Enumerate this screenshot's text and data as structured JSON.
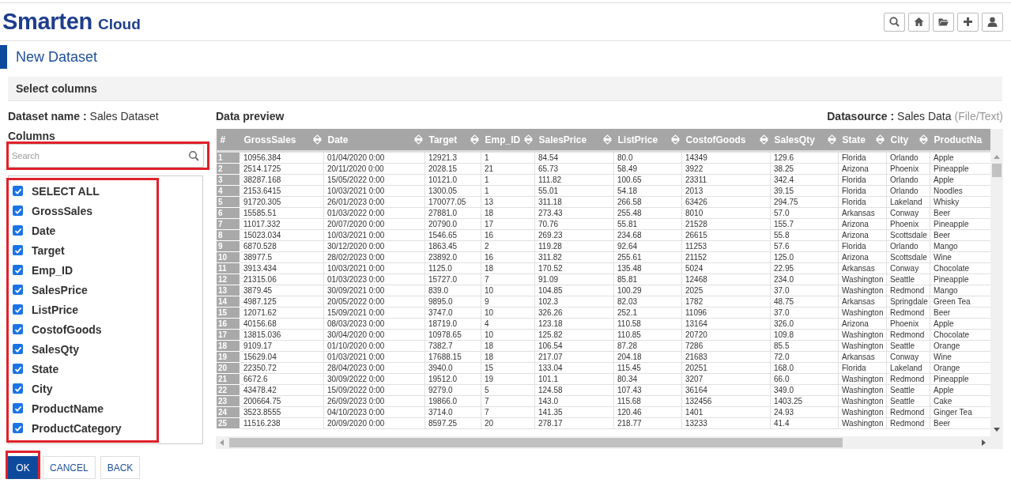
{
  "header": {
    "logo": {
      "brand": "Smarten",
      "product": "Cloud"
    },
    "toolbar": [
      {
        "kind": "search"
      },
      {
        "kind": "home"
      },
      {
        "kind": "folder"
      },
      {
        "kind": "plus"
      },
      {
        "kind": "user"
      }
    ]
  },
  "page_title": "New Dataset",
  "section_title": "Select columns",
  "dataset_name": {
    "label": "Dataset name :",
    "value": "Sales Dataset"
  },
  "columns": {
    "label": "Columns",
    "search": {
      "placeholder": "Search"
    },
    "items": [
      {
        "label": "SELECT ALL",
        "checked": true
      },
      {
        "label": "GrossSales",
        "checked": true
      },
      {
        "label": "Date",
        "checked": true
      },
      {
        "label": "Target",
        "checked": true
      },
      {
        "label": "Emp_ID",
        "checked": true
      },
      {
        "label": "SalesPrice",
        "checked": true
      },
      {
        "label": "ListPrice",
        "checked": true
      },
      {
        "label": "CostofGoods",
        "checked": true
      },
      {
        "label": "SalesQty",
        "checked": true
      },
      {
        "label": "State",
        "checked": true
      },
      {
        "label": "City",
        "checked": true
      },
      {
        "label": "ProductName",
        "checked": true
      },
      {
        "label": "ProductCategory",
        "checked": true
      }
    ]
  },
  "preview": {
    "title": "Data preview",
    "datasource": {
      "label": "Datasource :",
      "value": "Sales Data",
      "type": "(File/Text)"
    },
    "table": {
      "columns": [
        "#",
        "GrossSales",
        "Date",
        "Target",
        "Emp_ID",
        "SalesPrice",
        "ListPrice",
        "CostofGoods",
        "SalesQty",
        "State",
        "City",
        "ProductNa"
      ],
      "rows": [
        [
          "1",
          "10956.384",
          "01/04/2020 0:00",
          "12921.3",
          "1",
          "84.54",
          "80.0",
          "14349",
          "129.6",
          "Florida",
          "Orlando",
          "Apple"
        ],
        [
          "2",
          "2514.1725",
          "20/11/2020 0:00",
          "2028.15",
          "21",
          "65.73",
          "58.49",
          "3922",
          "38.25",
          "Arizona",
          "Phoenix",
          "Pineapple"
        ],
        [
          "3",
          "38287.168",
          "15/05/2022 0:00",
          "10121.0",
          "1",
          "111.82",
          "100.65",
          "23311",
          "342.4",
          "Florida",
          "Orlando",
          "Apple"
        ],
        [
          "4",
          "2153.6415",
          "10/03/2021 0:00",
          "1300.05",
          "1",
          "55.01",
          "54.18",
          "2013",
          "39.15",
          "Florida",
          "Orlando",
          "Noodles"
        ],
        [
          "5",
          "91720.305",
          "26/01/2023 0:00",
          "170077.05",
          "13",
          "311.18",
          "266.58",
          "63426",
          "294.75",
          "Florida",
          "Lakeland",
          "Whisky"
        ],
        [
          "6",
          "15585.51",
          "01/03/2022 0:00",
          "27881.0",
          "18",
          "273.43",
          "255.48",
          "8010",
          "57.0",
          "Arkansas",
          "Conway",
          "Beer"
        ],
        [
          "7",
          "11017.332",
          "20/07/2020 0:00",
          "20790.0",
          "17",
          "70.76",
          "55.81",
          "21528",
          "155.7",
          "Arizona",
          "Phoenix",
          "Pineapple"
        ],
        [
          "8",
          "15023.034",
          "10/03/2021 0:00",
          "1546.65",
          "16",
          "269.23",
          "234.68",
          "26615",
          "55.8",
          "Arizona",
          "Scottsdale",
          "Beer"
        ],
        [
          "9",
          "6870.528",
          "30/12/2020 0:00",
          "1863.45",
          "2",
          "119.28",
          "92.64",
          "11253",
          "57.6",
          "Florida",
          "Orlando",
          "Mango"
        ],
        [
          "10",
          "38977.5",
          "28/02/2023 0:00",
          "23892.0",
          "16",
          "311.82",
          "255.61",
          "21152",
          "125.0",
          "Arizona",
          "Scottsdale",
          "Wine"
        ],
        [
          "11",
          "3913.434",
          "10/03/2021 0:00",
          "1125.0",
          "18",
          "170.52",
          "135.48",
          "5024",
          "22.95",
          "Arkansas",
          "Conway",
          "Chocolate"
        ],
        [
          "12",
          "21315.06",
          "01/03/2023 0:00",
          "15727.0",
          "7",
          "91.09",
          "85.81",
          "12468",
          "234.0",
          "Washington",
          "Seattle",
          "Pineapple"
        ],
        [
          "13",
          "3879.45",
          "30/09/2021 0:00",
          "839.0",
          "10",
          "104.85",
          "100.29",
          "2025",
          "37.0",
          "Washington",
          "Redmond",
          "Mango"
        ],
        [
          "14",
          "4987.125",
          "20/05/2022 0:00",
          "9895.0",
          "9",
          "102.3",
          "82.03",
          "1782",
          "48.75",
          "Arkansas",
          "Springdale",
          "Green Tea"
        ],
        [
          "15",
          "12071.62",
          "15/09/2021 0:00",
          "3747.0",
          "10",
          "326.26",
          "252.1",
          "11096",
          "37.0",
          "Washington",
          "Redmond",
          "Beer"
        ],
        [
          "16",
          "40156.68",
          "08/03/2023 0:00",
          "18719.0",
          "4",
          "123.18",
          "110.58",
          "13164",
          "326.0",
          "Arizona",
          "Phoenix",
          "Apple"
        ],
        [
          "17",
          "13815.036",
          "30/04/2020 0:00",
          "10978.65",
          "10",
          "125.82",
          "110.85",
          "20720",
          "109.8",
          "Washington",
          "Redmond",
          "Chocolate"
        ],
        [
          "18",
          "9109.17",
          "01/10/2020 0:00",
          "7382.7",
          "18",
          "106.54",
          "87.28",
          "7286",
          "85.5",
          "Washington",
          "Seattle",
          "Orange"
        ],
        [
          "19",
          "15629.04",
          "01/03/2021 0:00",
          "17688.15",
          "18",
          "217.07",
          "204.18",
          "21683",
          "72.0",
          "Arkansas",
          "Conway",
          "Wine"
        ],
        [
          "20",
          "22350.72",
          "28/04/2023 0:00",
          "3940.0",
          "15",
          "133.04",
          "115.45",
          "20251",
          "168.0",
          "Florida",
          "Lakeland",
          "Orange"
        ],
        [
          "21",
          "6672.6",
          "30/09/2022 0:00",
          "19512.0",
          "19",
          "101.1",
          "80.34",
          "3207",
          "66.0",
          "Washington",
          "Redmond",
          "Pineapple"
        ],
        [
          "22",
          "43478.42",
          "15/09/2022 0:00",
          "9279.0",
          "5",
          "124.58",
          "107.43",
          "36164",
          "349.0",
          "Washington",
          "Seattle",
          "Apple"
        ],
        [
          "23",
          "200664.75",
          "26/09/2023 0:00",
          "19866.0",
          "7",
          "143.0",
          "115.68",
          "132456",
          "1403.25",
          "Washington",
          "Seattle",
          "Cake"
        ],
        [
          "24",
          "3523.8555",
          "04/10/2023 0:00",
          "3714.0",
          "7",
          "141.35",
          "120.46",
          "1401",
          "24.93",
          "Washington",
          "Redmond",
          "Ginger Tea"
        ],
        [
          "25",
          "11516.238",
          "20/09/2020 0:00",
          "8597.25",
          "20",
          "278.17",
          "218.77",
          "13233",
          "41.4",
          "Washington",
          "Redmond",
          "Beer"
        ]
      ]
    }
  },
  "buttons": [
    {
      "label": "OK",
      "kind": "primary"
    },
    {
      "label": "CANCEL",
      "kind": "secondary"
    },
    {
      "label": "BACK",
      "kind": "secondary"
    }
  ]
}
